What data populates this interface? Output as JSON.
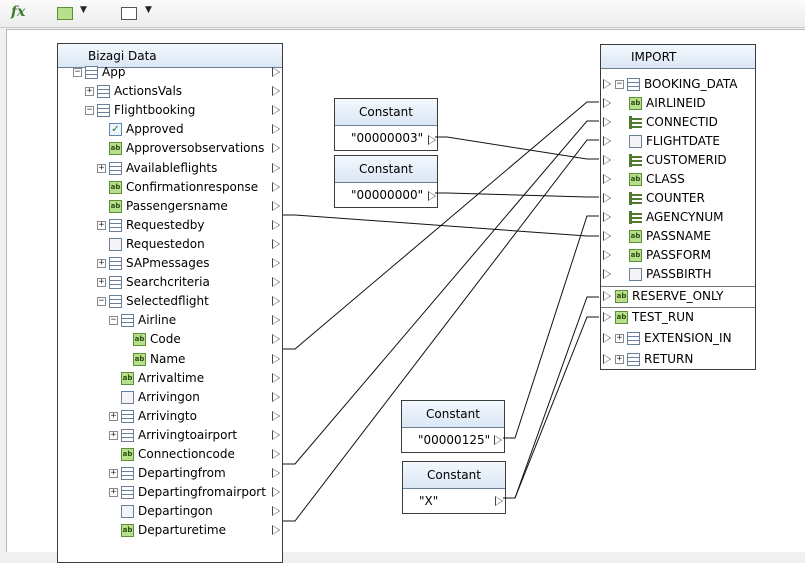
{
  "toolbar": {
    "fx_label": "fx",
    "icons": [
      "text-field-icon",
      "function-icon"
    ]
  },
  "bizagi_panel": {
    "title": "Bizagi Data",
    "nodes": [
      {
        "label": "App",
        "icon": "entity-icon",
        "expander": "minus"
      },
      {
        "label": "ActionsVals",
        "icon": "entity-icon",
        "expander": "plus"
      },
      {
        "label": "Flightbooking",
        "icon": "entity-icon",
        "expander": "minus"
      },
      {
        "label": "Approved",
        "icon": "checkbox-icon"
      },
      {
        "label": "Approversobservations",
        "icon": "text-icon"
      },
      {
        "label": "Availableflights",
        "icon": "entity-icon",
        "expander": "plus"
      },
      {
        "label": "Confirmationresponse",
        "icon": "text-icon"
      },
      {
        "label": "Passengersname",
        "icon": "text-icon"
      },
      {
        "label": "Requestedby",
        "icon": "entity-icon",
        "expander": "plus"
      },
      {
        "label": "Requestedon",
        "icon": "date-icon"
      },
      {
        "label": "SAPmessages",
        "icon": "entity-icon",
        "expander": "plus"
      },
      {
        "label": "Searchcriteria",
        "icon": "entity-icon",
        "expander": "plus"
      },
      {
        "label": "Selectedflight",
        "icon": "entity-icon",
        "expander": "minus"
      },
      {
        "label": "Airline",
        "icon": "entity-icon",
        "expander": "minus"
      },
      {
        "label": "Code",
        "icon": "text-icon"
      },
      {
        "label": "Name",
        "icon": "text-icon"
      },
      {
        "label": "Arrivaltime",
        "icon": "text-icon"
      },
      {
        "label": "Arrivingon",
        "icon": "date-icon"
      },
      {
        "label": "Arrivingto",
        "icon": "entity-icon",
        "expander": "plus"
      },
      {
        "label": "Arrivingtoairport",
        "icon": "entity-icon",
        "expander": "plus"
      },
      {
        "label": "Connectioncode",
        "icon": "text-icon"
      },
      {
        "label": "Departingfrom",
        "icon": "entity-icon",
        "expander": "plus"
      },
      {
        "label": "Departingfromairport",
        "icon": "entity-icon",
        "expander": "plus"
      },
      {
        "label": "Departingon",
        "icon": "date-icon"
      },
      {
        "label": "Departuretime",
        "icon": "text-icon"
      }
    ]
  },
  "import_panel": {
    "title": "IMPORT",
    "nodes": [
      {
        "label": "BOOKING_DATA",
        "icon": "entity-icon",
        "expander": "minus"
      },
      {
        "label": "AIRLINEID",
        "icon": "text-icon"
      },
      {
        "label": "CONNECTID",
        "icon": "number-icon"
      },
      {
        "label": "FLIGHTDATE",
        "icon": "date-icon"
      },
      {
        "label": "CUSTOMERID",
        "icon": "number-icon"
      },
      {
        "label": "CLASS",
        "icon": "text-icon"
      },
      {
        "label": "COUNTER",
        "icon": "number-icon"
      },
      {
        "label": "AGENCYNUM",
        "icon": "number-icon"
      },
      {
        "label": "PASSNAME",
        "icon": "text-icon"
      },
      {
        "label": "PASSFORM",
        "icon": "text-icon"
      },
      {
        "label": "PASSBIRTH",
        "icon": "date-icon"
      },
      {
        "label": "RESERVE_ONLY",
        "icon": "text-icon"
      },
      {
        "label": "TEST_RUN",
        "icon": "text-icon"
      },
      {
        "label": "EXTENSION_IN",
        "icon": "table-icon",
        "expander": "plus"
      },
      {
        "label": "RETURN",
        "icon": "table-icon",
        "expander": "plus"
      }
    ]
  },
  "constants": [
    {
      "title": "Constant",
      "value": "\"00000003\""
    },
    {
      "title": "Constant",
      "value": "\"00000000\""
    },
    {
      "title": "Constant",
      "value": "\"00000125\""
    },
    {
      "title": "Constant",
      "value": "\"X\""
    }
  ],
  "mappings": [
    {
      "from": "Passengersname",
      "to": "PASSNAME"
    },
    {
      "from": "Code",
      "to": "AIRLINEID"
    },
    {
      "from": "Connectioncode",
      "to": "CONNECTID"
    },
    {
      "from": "Departingon",
      "to": "FLIGHTDATE"
    },
    {
      "from": "\"00000003\"",
      "to": "CUSTOMERID"
    },
    {
      "from": "\"00000000\"",
      "to": "COUNTER"
    },
    {
      "from": "\"00000125\"",
      "to": "AGENCYNUM"
    },
    {
      "from": "\"X\"",
      "to": "RESERVE_ONLY"
    },
    {
      "from": "\"X\"",
      "to": "TEST_RUN"
    }
  ]
}
